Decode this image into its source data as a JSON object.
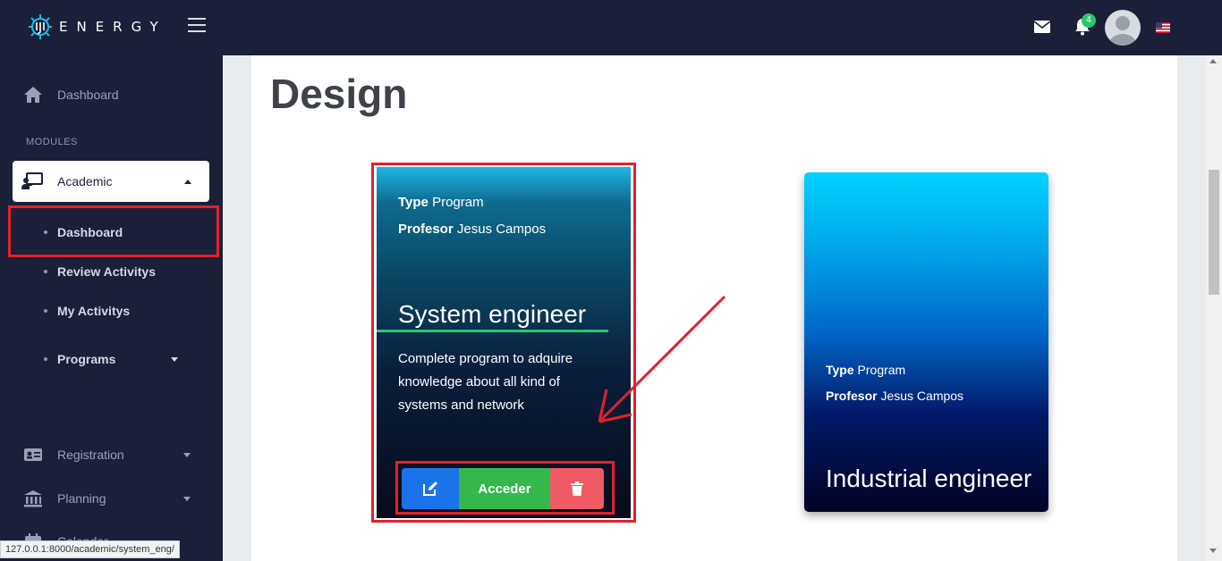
{
  "header": {
    "brand": "ENERGY",
    "notification_count": "4"
  },
  "sidebar": {
    "dashboard_label": "Dashboard",
    "modules_label": "MODULES",
    "academic_label": "Academic",
    "academic_items": [
      {
        "label": "Dashboard"
      },
      {
        "label": "Review Activitys"
      },
      {
        "label": "My Activitys"
      },
      {
        "label": "Programs"
      }
    ],
    "registration_label": "Registration",
    "planning_label": "Planning",
    "partial_item_label": "Calendar"
  },
  "main": {
    "title": "Design",
    "cards": [
      {
        "type_key": "Type",
        "type_value": "Program",
        "professor_key": "Profesor",
        "professor_value": "Jesus Campos",
        "title": "System engineer",
        "description": "Complete program to adquire knowledge about all kind of systems and network",
        "access_label": "Acceder"
      },
      {
        "type_key": "Type",
        "type_value": "Program",
        "professor_key": "Profesor",
        "professor_value": "Jesus Campos",
        "title": "Industrial engineer"
      }
    ]
  },
  "status_url": "127.0.0.1:8000/academic/system_eng/",
  "colors": {
    "topbar": "#1b2038",
    "sidebar": "#1b2038",
    "highlight": "#e3202d",
    "accent_green": "#28c76f",
    "edit_blue": "#1a73e8",
    "access_green": "#34b84b",
    "delete_red": "#ef5a64"
  }
}
